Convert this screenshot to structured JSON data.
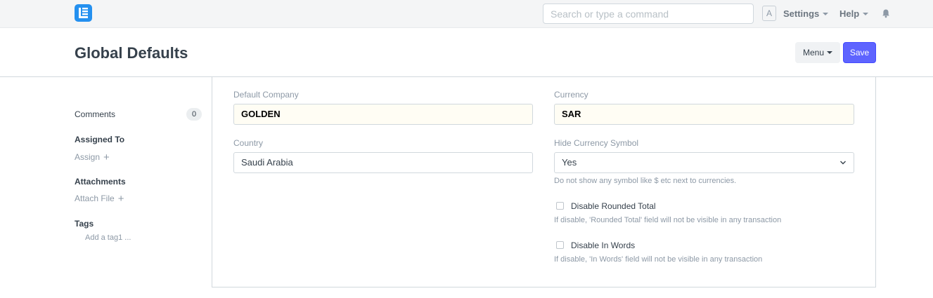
{
  "navbar": {
    "search_placeholder": "Search or type a command",
    "avatar_letter": "A",
    "settings_label": "Settings",
    "help_label": "Help"
  },
  "header": {
    "title": "Global Defaults",
    "menu_label": "Menu",
    "save_label": "Save"
  },
  "sidebar": {
    "comments_label": "Comments",
    "comments_count": "0",
    "assigned_to_label": "Assigned To",
    "assign_label": "Assign",
    "attachments_label": "Attachments",
    "attach_file_label": "Attach File",
    "tags_label": "Tags",
    "add_tag_label": "Add a tag1 ..."
  },
  "form": {
    "default_company": {
      "label": "Default Company",
      "value": "GOLDEN"
    },
    "country": {
      "label": "Country",
      "value": "Saudi Arabia"
    },
    "currency": {
      "label": "Currency",
      "value": "SAR"
    },
    "hide_currency_symbol": {
      "label": "Hide Currency Symbol",
      "value": "Yes",
      "help": "Do not show any symbol like $ etc next to currencies."
    },
    "disable_rounded_total": {
      "label": "Disable Rounded Total",
      "checked": false,
      "help": "If disable, 'Rounded Total' field will not be visible in any transaction"
    },
    "disable_in_words": {
      "label": "Disable In Words",
      "checked": false,
      "help": "If disable, 'In Words' field will not be visible in any transaction"
    }
  },
  "colors": {
    "primary": "#5e64ff",
    "logo": "#2490ef",
    "link_field_bg": "#fffdf4"
  }
}
